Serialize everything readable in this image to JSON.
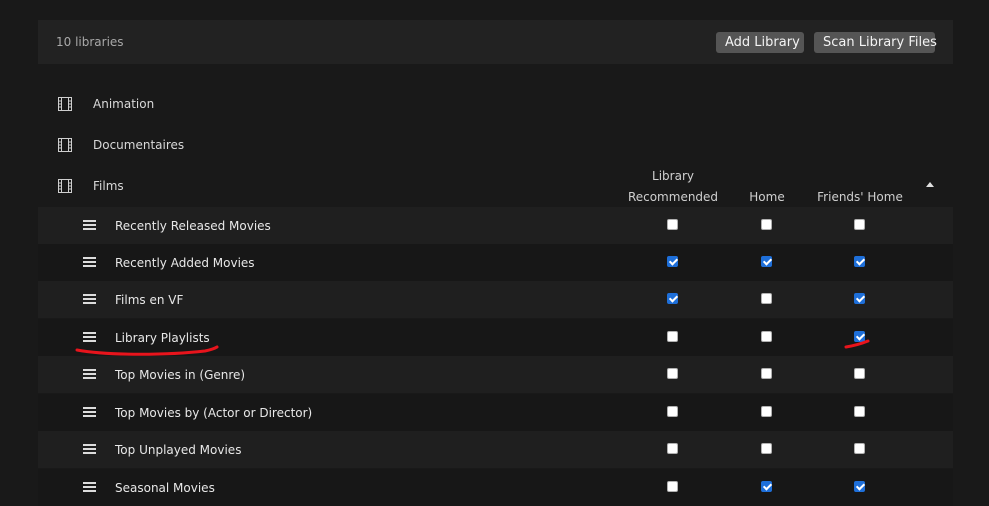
{
  "header": {
    "library_count": "10 libraries",
    "add_library_label": "Add Library",
    "scan_library_files_label": "Scan Library Files"
  },
  "libraries": [
    {
      "label": "Animation",
      "icon": "film-icon"
    },
    {
      "label": "Documentaires",
      "icon": "film-icon"
    },
    {
      "label": "Films",
      "icon": "film-icon"
    }
  ],
  "columns": {
    "library_recommended_line1": "Library",
    "library_recommended_line2": "Recommended",
    "home": "Home",
    "friends_home": "Friends' Home",
    "sort_icon": "sort-up-icon"
  },
  "hubs": [
    {
      "label": "Recently Released Movies",
      "library_recommended": false,
      "home": false,
      "friends_home": false
    },
    {
      "label": "Recently Added Movies",
      "library_recommended": true,
      "home": true,
      "friends_home": true
    },
    {
      "label": "Films en VF",
      "library_recommended": true,
      "home": false,
      "friends_home": true
    },
    {
      "label": "Library Playlists",
      "library_recommended": false,
      "home": false,
      "friends_home": true
    },
    {
      "label": "Top Movies in (Genre)",
      "library_recommended": false,
      "home": false,
      "friends_home": false
    },
    {
      "label": "Top Movies by (Actor or Director)",
      "library_recommended": false,
      "home": false,
      "friends_home": false
    },
    {
      "label": "Top Unplayed Movies",
      "library_recommended": false,
      "home": false,
      "friends_home": false
    },
    {
      "label": "Seasonal Movies",
      "library_recommended": false,
      "home": true,
      "friends_home": true
    }
  ],
  "colors": {
    "background": "#191919",
    "checkbox_checked": "#1e6fd9",
    "annotation": "#e8141c"
  }
}
